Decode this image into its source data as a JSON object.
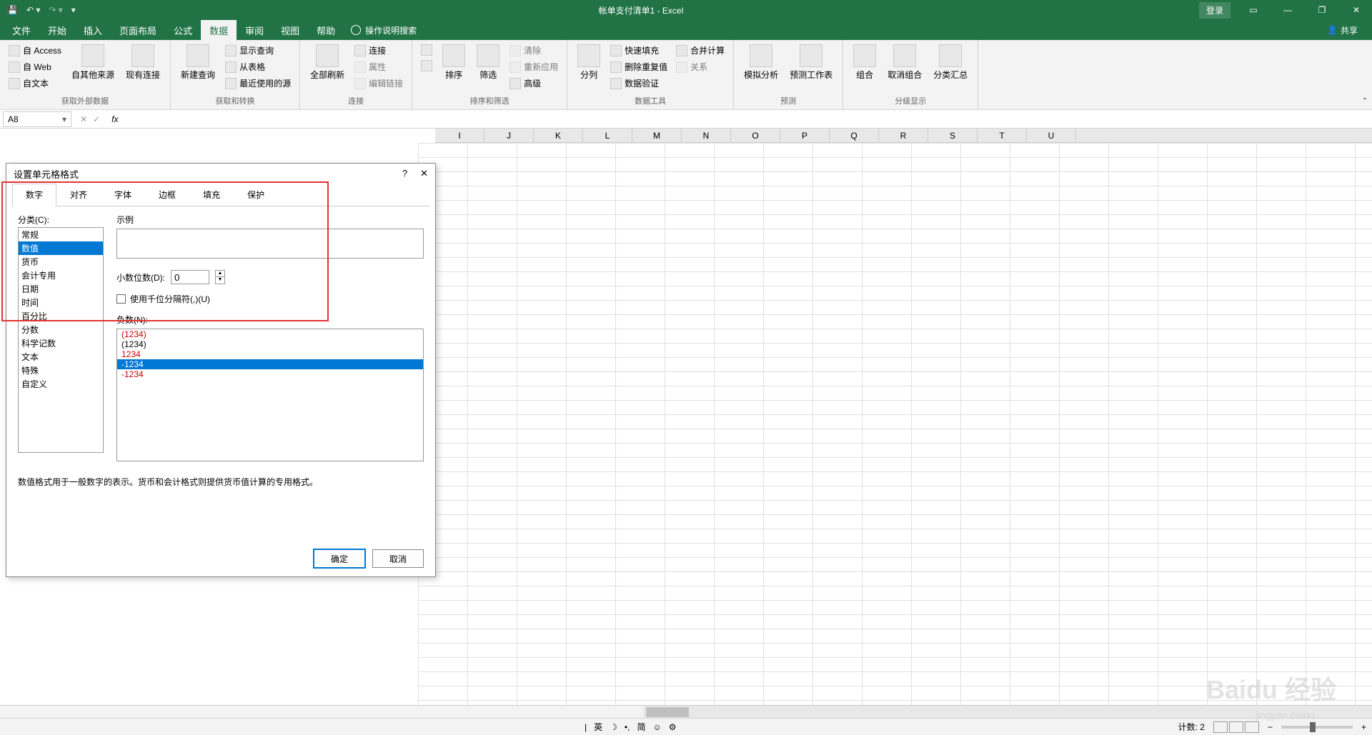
{
  "titleBar": {
    "title": "帐单支付清单1 - Excel",
    "login": "登录"
  },
  "menu": {
    "file": "文件",
    "home": "开始",
    "insert": "插入",
    "pageLayout": "页面布局",
    "formulas": "公式",
    "data": "数据",
    "review": "审阅",
    "view": "视图",
    "help": "帮助",
    "tellMe": "操作说明搜索",
    "share": "共享"
  },
  "ribbon": {
    "group1": {
      "label": "获取外部数据",
      "access": "自 Access",
      "web": "自 Web",
      "text": "自文本",
      "other": "自其他来源",
      "existing": "现有连接"
    },
    "group2": {
      "label": "获取和转换",
      "newQuery": "新建查询",
      "showQuery": "显示查询",
      "fromTable": "从表格",
      "recentSources": "最近使用的源"
    },
    "group3": {
      "label": "连接",
      "refreshAll": "全部刷新",
      "connections": "连接",
      "properties": "属性",
      "editLinks": "编辑链接"
    },
    "group4": {
      "label": "排序和筛选",
      "sort": "排序",
      "filter": "筛选",
      "clear": "清除",
      "reapply": "重新应用",
      "advanced": "高级"
    },
    "group5": {
      "label": "数据工具",
      "textToCol": "分列",
      "flashFill": "快速填充",
      "removeDup": "删除重复值",
      "dataValidation": "数据验证",
      "consolidate": "合并计算",
      "relationships": "关系"
    },
    "group6": {
      "label": "预测",
      "whatIf": "模拟分析",
      "forecast": "预测工作表"
    },
    "group7": {
      "label": "分级显示",
      "group": "组合",
      "ungroup": "取消组合",
      "subtotal": "分类汇总"
    }
  },
  "nameBox": "A8",
  "columns": [
    "I",
    "J",
    "K",
    "L",
    "M",
    "N",
    "O",
    "P",
    "Q",
    "R",
    "S",
    "T",
    "U"
  ],
  "dialog": {
    "title": "设置单元格格式",
    "tabs": {
      "number": "数字",
      "alignment": "对齐",
      "font": "字体",
      "border": "边框",
      "fill": "填充",
      "protection": "保护"
    },
    "categoryLabel": "分类(C):",
    "categories": [
      "常规",
      "数值",
      "货币",
      "会计专用",
      "日期",
      "时间",
      "百分比",
      "分数",
      "科学记数",
      "文本",
      "特殊",
      "自定义"
    ],
    "sample": "示例",
    "decimalLabel": "小数位数(D):",
    "decimalValue": "0",
    "thousandsLabel": "使用千位分隔符(,)(U)",
    "negLabel": "负数(N):",
    "negatives": [
      {
        "text": "(1234)",
        "red": true
      },
      {
        "text": "(1234)",
        "red": false
      },
      {
        "text": "1234",
        "red": true
      },
      {
        "text": "-1234",
        "red": false,
        "selected": true
      },
      {
        "text": "-1234",
        "red": true
      }
    ],
    "desc": "数值格式用于一般数字的表示。货币和会计格式则提供货币值计算的专用格式。",
    "ok": "确定",
    "cancel": "取消"
  },
  "statusBar": {
    "count": "计数: 2",
    "ime": [
      "英",
      "简"
    ],
    "zoom": "+"
  },
  "watermark": {
    "main": "Baidu 经验",
    "sub": "jingyan.baidu"
  }
}
